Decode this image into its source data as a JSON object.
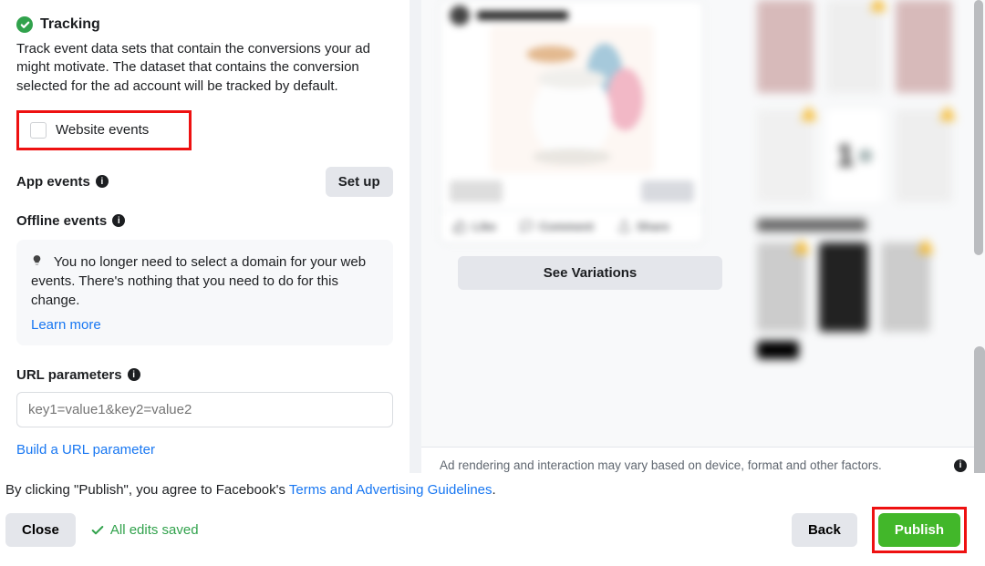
{
  "tracking": {
    "title": "Tracking",
    "description": "Track event data sets that contain the conversions your ad might motivate. The dataset that contains the conversion selected for the ad account will be tracked by default.",
    "website_events_label": "Website events",
    "app_events_label": "App events",
    "setup_button": "Set up",
    "offline_events_label": "Offline events",
    "note": "You no longer need to select a domain for your web events. There's nothing that you need to do for this change.",
    "learn_more": "Learn more",
    "url_parameters_label": "URL parameters",
    "url_placeholder": "key1=value1&key2=value2",
    "build_url_link": "Build a URL parameter"
  },
  "preview": {
    "like": "Like",
    "comment": "Comment",
    "share": "Share",
    "see_variations": "See Variations",
    "rendering_note": "Ad rendering and interaction may vary based on device, format and other factors."
  },
  "footer": {
    "terms_prefix": "By clicking \"Publish\", you agree to Facebook's ",
    "terms_link": "Terms and Advertising Guidelines",
    "terms_suffix": ".",
    "close": "Close",
    "saved": "All edits saved",
    "back": "Back",
    "publish": "Publish"
  }
}
